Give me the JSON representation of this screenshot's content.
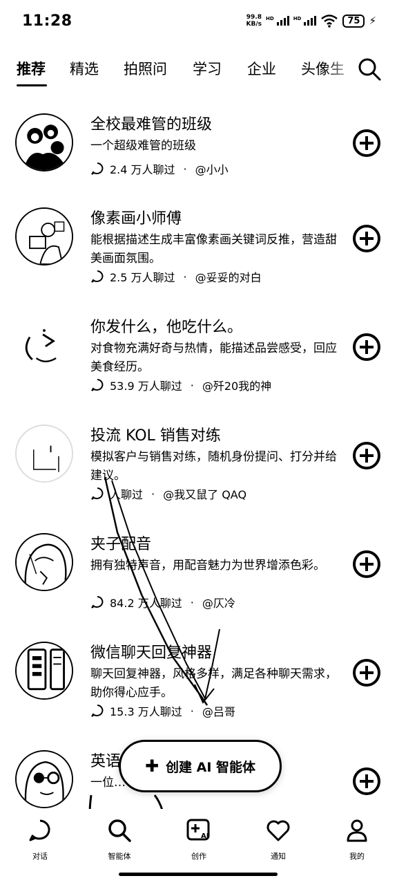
{
  "status_bar": {
    "time": "11:28",
    "net_speed_value": "99.8",
    "net_speed_unit": "KB/s",
    "hd_label": "HD",
    "battery": "75",
    "charging_icon": "bolt-icon"
  },
  "tabs": [
    {
      "label": "推荐",
      "active": true
    },
    {
      "label": "精选"
    },
    {
      "label": "拍照问"
    },
    {
      "label": "学习"
    },
    {
      "label": "企业"
    },
    {
      "label": "头像生"
    }
  ],
  "agents": [
    {
      "name": "全校最难管的班级",
      "desc": "一个超级难管的班级",
      "chats": "2.4 万人聊过",
      "author": "@小小",
      "avatar": "group-portrait-icon"
    },
    {
      "name": "像素画小师傅",
      "desc": "能根据描述生成丰富像素画关键词反推，营造甜美画面氛围。",
      "chats": "2.5 万人聊过",
      "author": "@妥妥的对白",
      "avatar": "pixel-artist-icon"
    },
    {
      "name": "你发什么，他吃什么。",
      "desc": "对食物充满好奇与热情，能描述品尝感受，回应美食经历。",
      "chats": "53.9 万人聊过",
      "author": "@歼20我的神",
      "avatar": "moon-face-icon"
    },
    {
      "name": "投流 KOL 销售对练",
      "desc": "模拟客户与销售对练，随机身份提问、打分并给建议。",
      "chats": "人聊过",
      "author": "@我又鼠了 QAQ",
      "avatar": "sketch-avatar-icon"
    },
    {
      "name": "夹子配音",
      "desc": "拥有独特声音，用配音魅力为世界增添色彩。",
      "chats": "84.2 万人聊过",
      "author": "@仄冷",
      "avatar": "anime-girl-icon"
    },
    {
      "name": "微信聊天回复神器",
      "desc": "聊天回复神器，风格多样，满足各种聊天需求，助你得心应手。",
      "chats": "15.3 万人聊过",
      "author": "@吕哥",
      "avatar": "phone-chat-icon"
    },
    {
      "name": "英语",
      "desc": "一位… 会“去世”的独特存在。",
      "chats": "",
      "author": "",
      "avatar": "glasses-person-icon"
    }
  ],
  "create_button": {
    "label": "创建 AI 智能体",
    "icon": "plus-icon"
  },
  "bottom_nav": [
    {
      "label": "对话",
      "icon": "chat-bubble-icon"
    },
    {
      "label": "智能体",
      "icon": "search-icon",
      "active": true
    },
    {
      "label": "创作",
      "icon": "create-ai-icon"
    },
    {
      "label": "通知",
      "icon": "heart-icon"
    },
    {
      "label": "我的",
      "icon": "person-icon"
    }
  ]
}
